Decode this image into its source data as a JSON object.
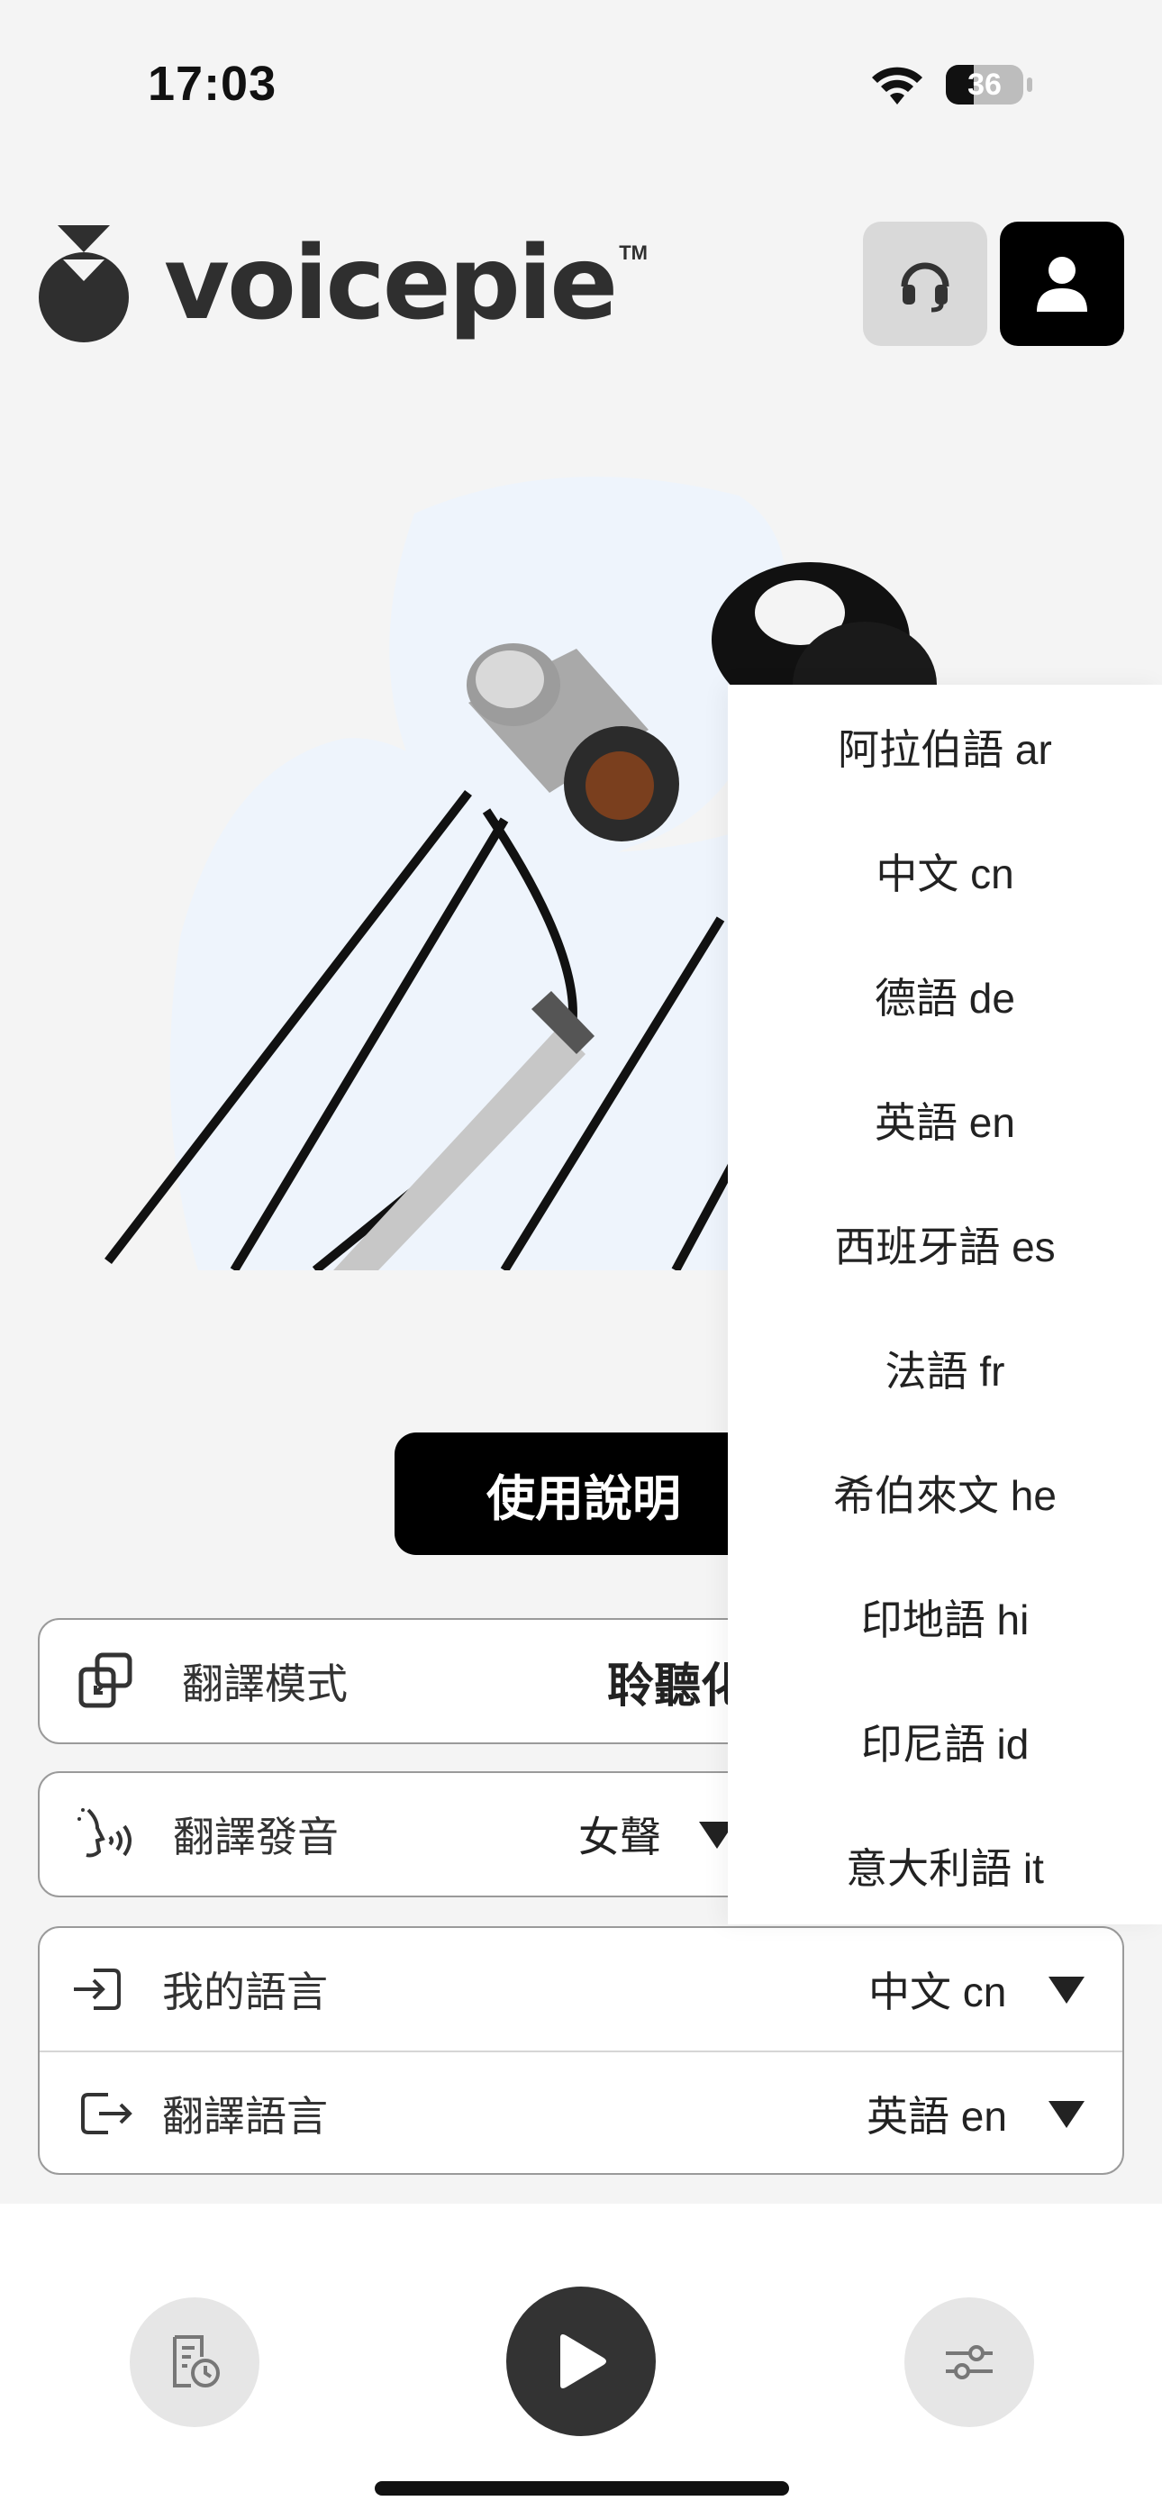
{
  "status_bar": {
    "time": "17:03",
    "battery": "36",
    "battery_level": 0.36
  },
  "header": {
    "brand": "voicepie",
    "trademark": "TM",
    "support_icon": "headset-icon",
    "account_icon": "user-icon"
  },
  "guide_button": {
    "label": "使用說明"
  },
  "settings": {
    "mode": {
      "label": "翻譯模式",
      "value": "聆聽化",
      "icon": "mode-switch-icon"
    },
    "voice": {
      "label": "翻譯發音",
      "value": "女聲",
      "icon": "speaking-voice-icon"
    },
    "my_language": {
      "label": "我的語言",
      "value": "中文 cn",
      "icon": "enter-icon"
    },
    "target_language": {
      "label": "翻譯語言",
      "value": "英語 en",
      "icon": "exit-icon"
    }
  },
  "language_menu": {
    "options": [
      "阿拉伯語 ar",
      "中文 cn",
      "德語 de",
      "英語 en",
      "西班牙語 es",
      "法語 fr",
      "希伯來文 he",
      "印地語 hi",
      "印尼語 id",
      "意大利語 it"
    ]
  },
  "bottom_bar": {
    "history_icon": "history-icon",
    "play_icon": "play-icon",
    "settings_icon": "sliders-icon"
  },
  "colors": {
    "accent": "#000000",
    "play_button": "#333333",
    "background": "#f4f4f4"
  }
}
